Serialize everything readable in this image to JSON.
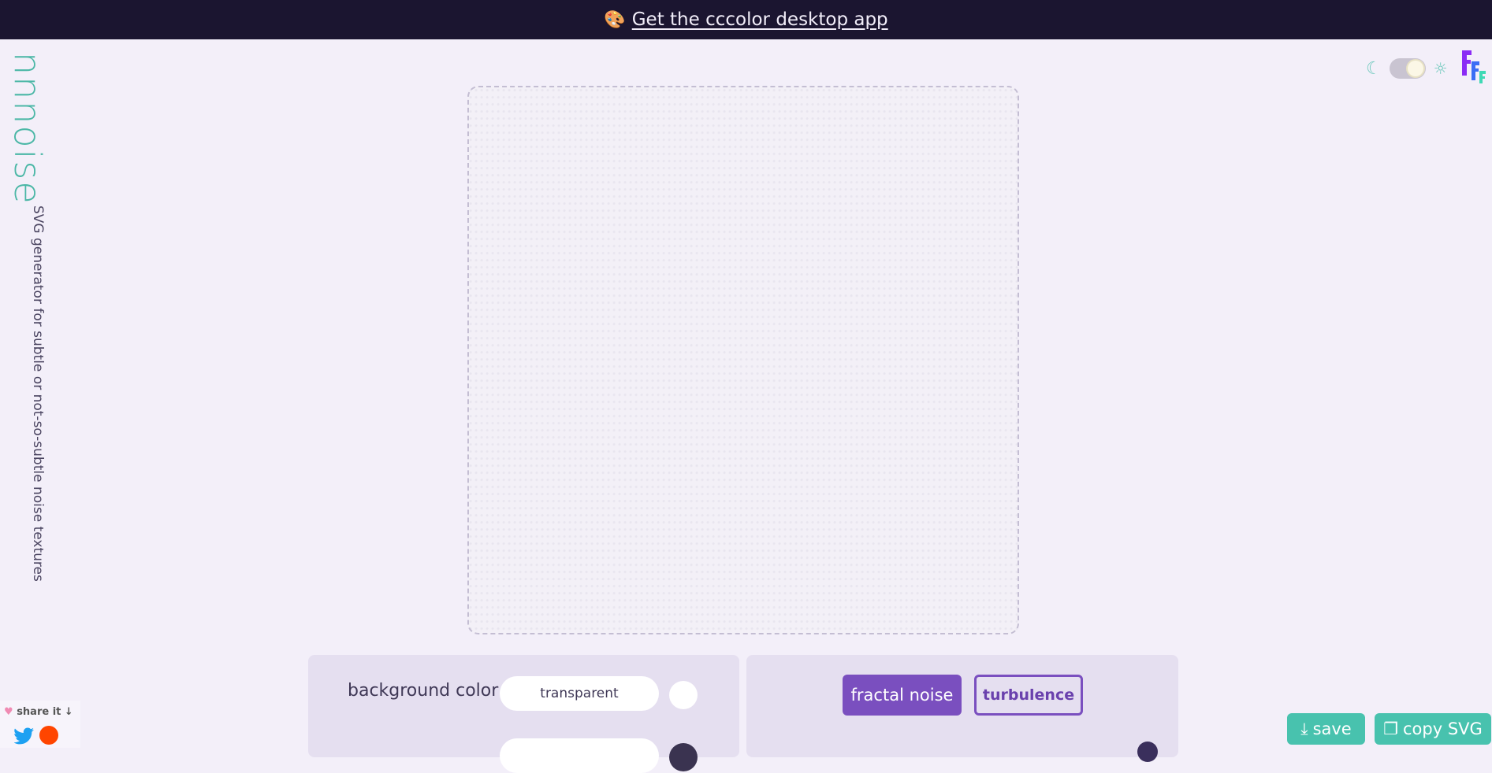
{
  "banner": {
    "emoji": "🎨",
    "link_text": "Get the cccolor desktop app"
  },
  "brand": {
    "name": "nnnoise",
    "tagline": "SVG generator for subtle or not-so-subtle noise textures"
  },
  "theme_toggle": {
    "dark_icon": "☾",
    "light_icon": "☼"
  },
  "controls": {
    "background": {
      "label": "background color",
      "value": "transparent",
      "swatch_color": "#ffffff"
    },
    "second_swatch_color": "#3a3350",
    "noise_types": {
      "fractal": "fractal noise",
      "turbulence": "turbulence"
    }
  },
  "share": {
    "label": "share it ↓"
  },
  "actions": {
    "save": "save",
    "copy": "copy SVG"
  },
  "colors": {
    "accent": "#48c2ae",
    "primary": "#7a4fbf",
    "banner_bg": "#1b1530"
  }
}
